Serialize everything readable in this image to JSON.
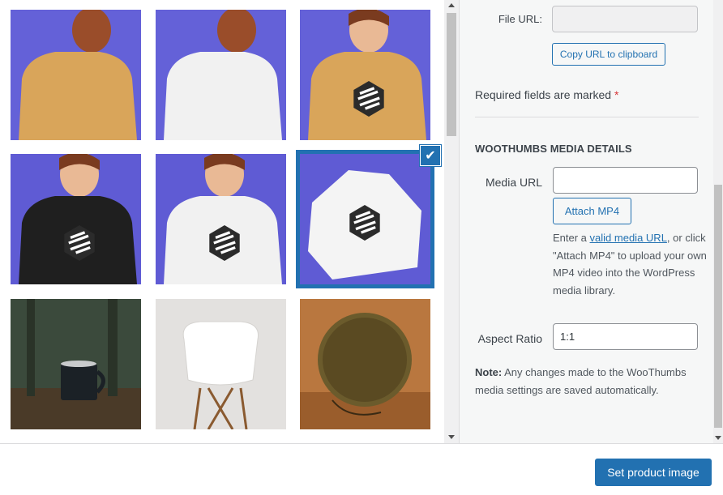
{
  "media_grid": {
    "items": [
      {
        "name": "woman-mustard-sweater-back",
        "bg": "#6461d8",
        "garment": "#d9a55a",
        "logo": false
      },
      {
        "name": "woman-white-sweater-back",
        "bg": "#6461d8",
        "garment": "#f1f1f1",
        "logo": false
      },
      {
        "name": "woman-mustard-sweater-front",
        "bg": "#6461d8",
        "garment": "#d9a55a",
        "logo": true
      },
      {
        "name": "woman-black-sweater-front",
        "bg": "#5f5bd4",
        "garment": "#1f1f1f",
        "logo": true
      },
      {
        "name": "woman-white-sweater-front",
        "bg": "#5f5bd4",
        "garment": "#f1f1f1",
        "logo": true
      },
      {
        "name": "white-sweater-flat",
        "bg": "#5f5bd4",
        "garment": "#f4f4f4",
        "logo": true
      },
      {
        "name": "camp-mug-forest",
        "bg": "#3b4a3c",
        "garment": "#1b2126",
        "logo": false
      },
      {
        "name": "white-chair",
        "bg": "#e3e1df",
        "garment": "#ffffff",
        "logo": false
      },
      {
        "name": "round-speaker",
        "bg": "#b9773f",
        "garment": "#5a4a22",
        "logo": false
      }
    ],
    "selected_index": 5
  },
  "sidebar": {
    "file_url_label": "File URL:",
    "file_url_value": "",
    "copy_url_button": "Copy URL to clipboard",
    "required_note": "Required fields are marked",
    "required_star": "*",
    "section_title": "WooThumbs Media Details",
    "media_url_label": "Media URL",
    "media_url_value": "",
    "attach_button": "Attach MP4",
    "help_prefix": "Enter a",
    "help_link": "valid media URL",
    "help_suffix": ", or click \"Attach MP4\" to upload your own MP4 video into the WordPress media library.",
    "aspect_ratio_label": "Aspect Ratio",
    "aspect_ratio_value": "1:1",
    "note_bold": "Note:",
    "note_text": " Any changes made to the WooThumbs media settings are saved automatically."
  },
  "footer": {
    "primary_button": "Set product image"
  },
  "colors": {
    "accent": "#2271b1",
    "required": "#d63638"
  }
}
